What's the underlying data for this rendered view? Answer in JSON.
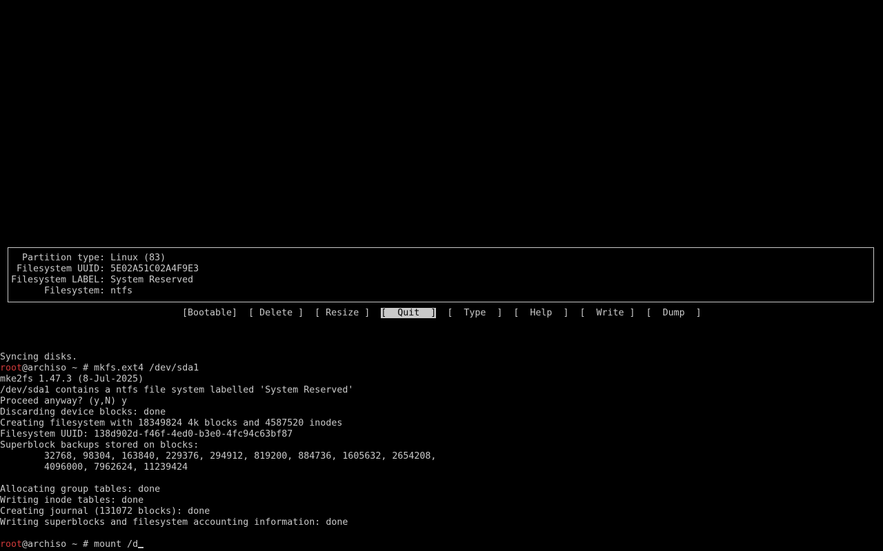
{
  "partition_info": {
    "rows": [
      {
        "label": "  Partition type:",
        "value": " Linux (83)"
      },
      {
        "label": " Filesystem UUID:",
        "value": " 5E02A51C02A4F9E3"
      },
      {
        "label": "Filesystem LABEL:",
        "value": " System Reserved"
      },
      {
        "label": "      Filesystem:",
        "value": " ntfs"
      }
    ]
  },
  "menu": {
    "items": [
      {
        "label": "[Bootable]"
      },
      {
        "label": "[ Delete ]"
      },
      {
        "label": "[ Resize ]"
      },
      {
        "label": "[  Quit  ]",
        "selected": true
      },
      {
        "label": "[  Type  ]"
      },
      {
        "label": "[  Help  ]"
      },
      {
        "label": "[  Write ]"
      },
      {
        "label": "[  Dump  ]"
      }
    ]
  },
  "terminal": {
    "prompt_user": "root",
    "prompt_rest": "@archiso ~ # ",
    "lines": [
      {
        "type": "text",
        "text": "Syncing disks."
      },
      {
        "type": "prompt",
        "command": "mkfs.ext4 /dev/sda1"
      },
      {
        "type": "text",
        "text": "mke2fs 1.47.3 (8-Jul-2025)"
      },
      {
        "type": "text",
        "text": "/dev/sda1 contains a ntfs file system labelled 'System Reserved'"
      },
      {
        "type": "text",
        "text": "Proceed anyway? (y,N) y"
      },
      {
        "type": "text",
        "text": "Discarding device blocks: done"
      },
      {
        "type": "text",
        "text": "Creating filesystem with 18349824 4k blocks and 4587520 inodes"
      },
      {
        "type": "text",
        "text": "Filesystem UUID: 138d902d-f46f-4ed0-b3e0-4fc94c63bf87"
      },
      {
        "type": "text",
        "text": "Superblock backups stored on blocks:"
      },
      {
        "type": "text",
        "text": "        32768, 98304, 163840, 229376, 294912, 819200, 884736, 1605632, 2654208,"
      },
      {
        "type": "text",
        "text": "        4096000, 7962624, 11239424"
      },
      {
        "type": "text",
        "text": ""
      },
      {
        "type": "text",
        "text": "Allocating group tables: done"
      },
      {
        "type": "text",
        "text": "Writing inode tables: done"
      },
      {
        "type": "text",
        "text": "Creating journal (131072 blocks): done"
      },
      {
        "type": "text",
        "text": "Writing superblocks and filesystem accounting information: done"
      },
      {
        "type": "text",
        "text": ""
      },
      {
        "type": "prompt",
        "command": "mount /d",
        "cursor": true
      }
    ]
  },
  "colors": {
    "background": "#000000",
    "foreground": "#c9c9c9",
    "prompt_user": "#d03a3a"
  }
}
